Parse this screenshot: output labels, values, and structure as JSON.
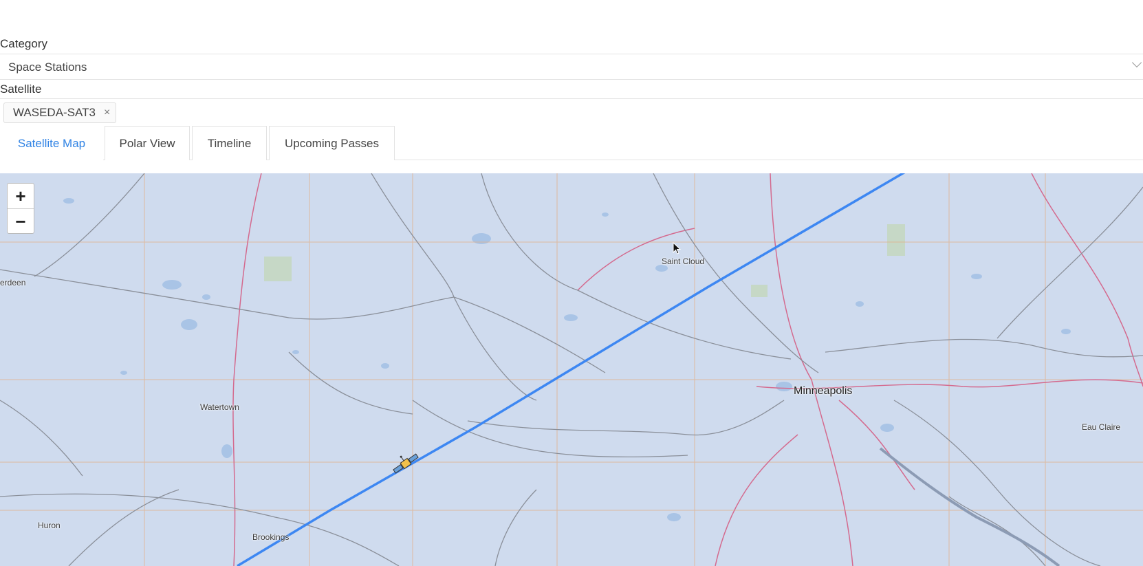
{
  "category": {
    "label": "Category",
    "value": "Space Stations"
  },
  "satellite": {
    "label": "Satellite",
    "tag": "WASEDA-SAT3",
    "remove": "×"
  },
  "tabs": [
    {
      "label": "Satellite Map",
      "active": true
    },
    {
      "label": "Polar View"
    },
    {
      "label": "Timeline"
    },
    {
      "label": "Upcoming Passes"
    }
  ],
  "map": {
    "zoom_in": "+",
    "zoom_out": "−",
    "cities": [
      "erdeen",
      "Saint Cloud",
      "Watertown",
      "Minneapolis",
      "Eau Claire",
      "Huron",
      "Brookings"
    ],
    "track_color": "#3d87f2",
    "satellite_icon": "satellite-icon"
  },
  "colors": {
    "accent": "#3083e4",
    "map_bg": "#cfdbee",
    "water": "#a9c4e6",
    "road": "#8a8f99",
    "highway": "#d46a8e",
    "minor_road": "#e2b28c"
  }
}
